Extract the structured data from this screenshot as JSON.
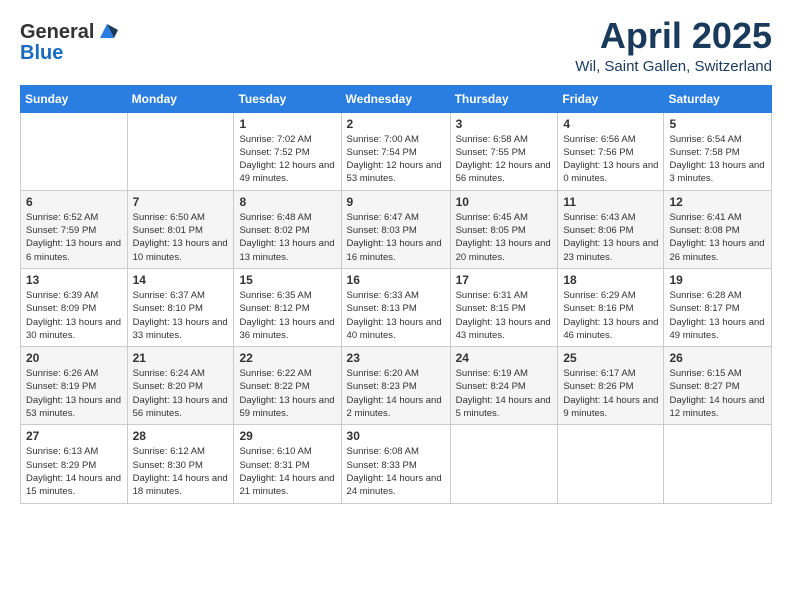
{
  "header": {
    "logo_general": "General",
    "logo_blue": "Blue",
    "month_title": "April 2025",
    "location": "Wil, Saint Gallen, Switzerland"
  },
  "days_of_week": [
    "Sunday",
    "Monday",
    "Tuesday",
    "Wednesday",
    "Thursday",
    "Friday",
    "Saturday"
  ],
  "weeks": [
    [
      {
        "day": "",
        "info": ""
      },
      {
        "day": "",
        "info": ""
      },
      {
        "day": "1",
        "info": "Sunrise: 7:02 AM\nSunset: 7:52 PM\nDaylight: 12 hours and 49 minutes."
      },
      {
        "day": "2",
        "info": "Sunrise: 7:00 AM\nSunset: 7:54 PM\nDaylight: 12 hours and 53 minutes."
      },
      {
        "day": "3",
        "info": "Sunrise: 6:58 AM\nSunset: 7:55 PM\nDaylight: 12 hours and 56 minutes."
      },
      {
        "day": "4",
        "info": "Sunrise: 6:56 AM\nSunset: 7:56 PM\nDaylight: 13 hours and 0 minutes."
      },
      {
        "day": "5",
        "info": "Sunrise: 6:54 AM\nSunset: 7:58 PM\nDaylight: 13 hours and 3 minutes."
      }
    ],
    [
      {
        "day": "6",
        "info": "Sunrise: 6:52 AM\nSunset: 7:59 PM\nDaylight: 13 hours and 6 minutes."
      },
      {
        "day": "7",
        "info": "Sunrise: 6:50 AM\nSunset: 8:01 PM\nDaylight: 13 hours and 10 minutes."
      },
      {
        "day": "8",
        "info": "Sunrise: 6:48 AM\nSunset: 8:02 PM\nDaylight: 13 hours and 13 minutes."
      },
      {
        "day": "9",
        "info": "Sunrise: 6:47 AM\nSunset: 8:03 PM\nDaylight: 13 hours and 16 minutes."
      },
      {
        "day": "10",
        "info": "Sunrise: 6:45 AM\nSunset: 8:05 PM\nDaylight: 13 hours and 20 minutes."
      },
      {
        "day": "11",
        "info": "Sunrise: 6:43 AM\nSunset: 8:06 PM\nDaylight: 13 hours and 23 minutes."
      },
      {
        "day": "12",
        "info": "Sunrise: 6:41 AM\nSunset: 8:08 PM\nDaylight: 13 hours and 26 minutes."
      }
    ],
    [
      {
        "day": "13",
        "info": "Sunrise: 6:39 AM\nSunset: 8:09 PM\nDaylight: 13 hours and 30 minutes."
      },
      {
        "day": "14",
        "info": "Sunrise: 6:37 AM\nSunset: 8:10 PM\nDaylight: 13 hours and 33 minutes."
      },
      {
        "day": "15",
        "info": "Sunrise: 6:35 AM\nSunset: 8:12 PM\nDaylight: 13 hours and 36 minutes."
      },
      {
        "day": "16",
        "info": "Sunrise: 6:33 AM\nSunset: 8:13 PM\nDaylight: 13 hours and 40 minutes."
      },
      {
        "day": "17",
        "info": "Sunrise: 6:31 AM\nSunset: 8:15 PM\nDaylight: 13 hours and 43 minutes."
      },
      {
        "day": "18",
        "info": "Sunrise: 6:29 AM\nSunset: 8:16 PM\nDaylight: 13 hours and 46 minutes."
      },
      {
        "day": "19",
        "info": "Sunrise: 6:28 AM\nSunset: 8:17 PM\nDaylight: 13 hours and 49 minutes."
      }
    ],
    [
      {
        "day": "20",
        "info": "Sunrise: 6:26 AM\nSunset: 8:19 PM\nDaylight: 13 hours and 53 minutes."
      },
      {
        "day": "21",
        "info": "Sunrise: 6:24 AM\nSunset: 8:20 PM\nDaylight: 13 hours and 56 minutes."
      },
      {
        "day": "22",
        "info": "Sunrise: 6:22 AM\nSunset: 8:22 PM\nDaylight: 13 hours and 59 minutes."
      },
      {
        "day": "23",
        "info": "Sunrise: 6:20 AM\nSunset: 8:23 PM\nDaylight: 14 hours and 2 minutes."
      },
      {
        "day": "24",
        "info": "Sunrise: 6:19 AM\nSunset: 8:24 PM\nDaylight: 14 hours and 5 minutes."
      },
      {
        "day": "25",
        "info": "Sunrise: 6:17 AM\nSunset: 8:26 PM\nDaylight: 14 hours and 9 minutes."
      },
      {
        "day": "26",
        "info": "Sunrise: 6:15 AM\nSunset: 8:27 PM\nDaylight: 14 hours and 12 minutes."
      }
    ],
    [
      {
        "day": "27",
        "info": "Sunrise: 6:13 AM\nSunset: 8:29 PM\nDaylight: 14 hours and 15 minutes."
      },
      {
        "day": "28",
        "info": "Sunrise: 6:12 AM\nSunset: 8:30 PM\nDaylight: 14 hours and 18 minutes."
      },
      {
        "day": "29",
        "info": "Sunrise: 6:10 AM\nSunset: 8:31 PM\nDaylight: 14 hours and 21 minutes."
      },
      {
        "day": "30",
        "info": "Sunrise: 6:08 AM\nSunset: 8:33 PM\nDaylight: 14 hours and 24 minutes."
      },
      {
        "day": "",
        "info": ""
      },
      {
        "day": "",
        "info": ""
      },
      {
        "day": "",
        "info": ""
      }
    ]
  ]
}
